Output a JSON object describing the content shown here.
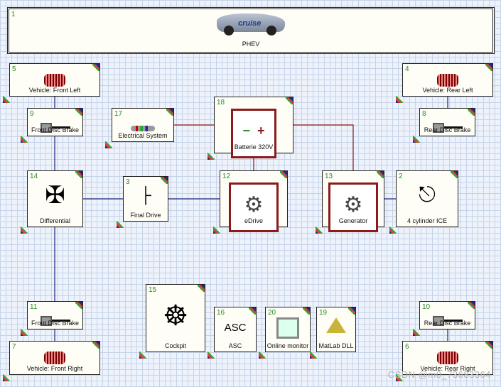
{
  "vehicle": {
    "number": "1",
    "label": "PHEV",
    "logo_text": "cruise"
  },
  "blocks": [
    {
      "id": "5",
      "label": "Vehicle: Front Left",
      "icon": "wheel-icon"
    },
    {
      "id": "4",
      "label": "Vehicle: Rear Left",
      "icon": "wheel-icon"
    },
    {
      "id": "9",
      "label": "Front Disc Brake",
      "icon": "disc-brake-icon"
    },
    {
      "id": "8",
      "label": "Rear Disc Brake",
      "icon": "disc-brake-icon"
    },
    {
      "id": "17",
      "label": "Electrical System",
      "icon": "resistor-icon"
    },
    {
      "id": "18",
      "label": "Batterie 320V",
      "icon": "battery-icon"
    },
    {
      "id": "14",
      "label": "Differential",
      "icon": "differential-icon"
    },
    {
      "id": "3",
      "label": "Final Drive",
      "icon": "final-drive-icon"
    },
    {
      "id": "12",
      "label": "eDrive",
      "icon": "electric-motor-icon"
    },
    {
      "id": "13",
      "label": "Generator",
      "icon": "electric-motor-icon"
    },
    {
      "id": "2",
      "label": "4 cylinder ICE",
      "icon": "piston-icon"
    },
    {
      "id": "15",
      "label": "Cockpit",
      "icon": "steering-wheel-icon"
    },
    {
      "id": "16",
      "label": "ASC",
      "icon": "asc-icon",
      "icon_text": "ASC"
    },
    {
      "id": "20",
      "label": "Online monitor",
      "icon": "monitor-icon"
    },
    {
      "id": "19",
      "label": "MatLab DLL",
      "icon": "matlab-icon"
    },
    {
      "id": "11",
      "label": "Front Disc Brake",
      "icon": "disc-brake-icon"
    },
    {
      "id": "7",
      "label": "Vehicle: Front Right",
      "icon": "wheel-icon"
    },
    {
      "id": "10",
      "label": "Rear Disc Brake",
      "icon": "disc-brake-icon"
    },
    {
      "id": "6",
      "label": "Vehicle: Rear Right",
      "icon": "wheel-icon"
    }
  ],
  "colors": {
    "mechanical": "#1a237e",
    "electrical": "#8b1a1a",
    "grid": "#c5d3ea"
  },
  "watermark": "CSDN @m0_73683364"
}
